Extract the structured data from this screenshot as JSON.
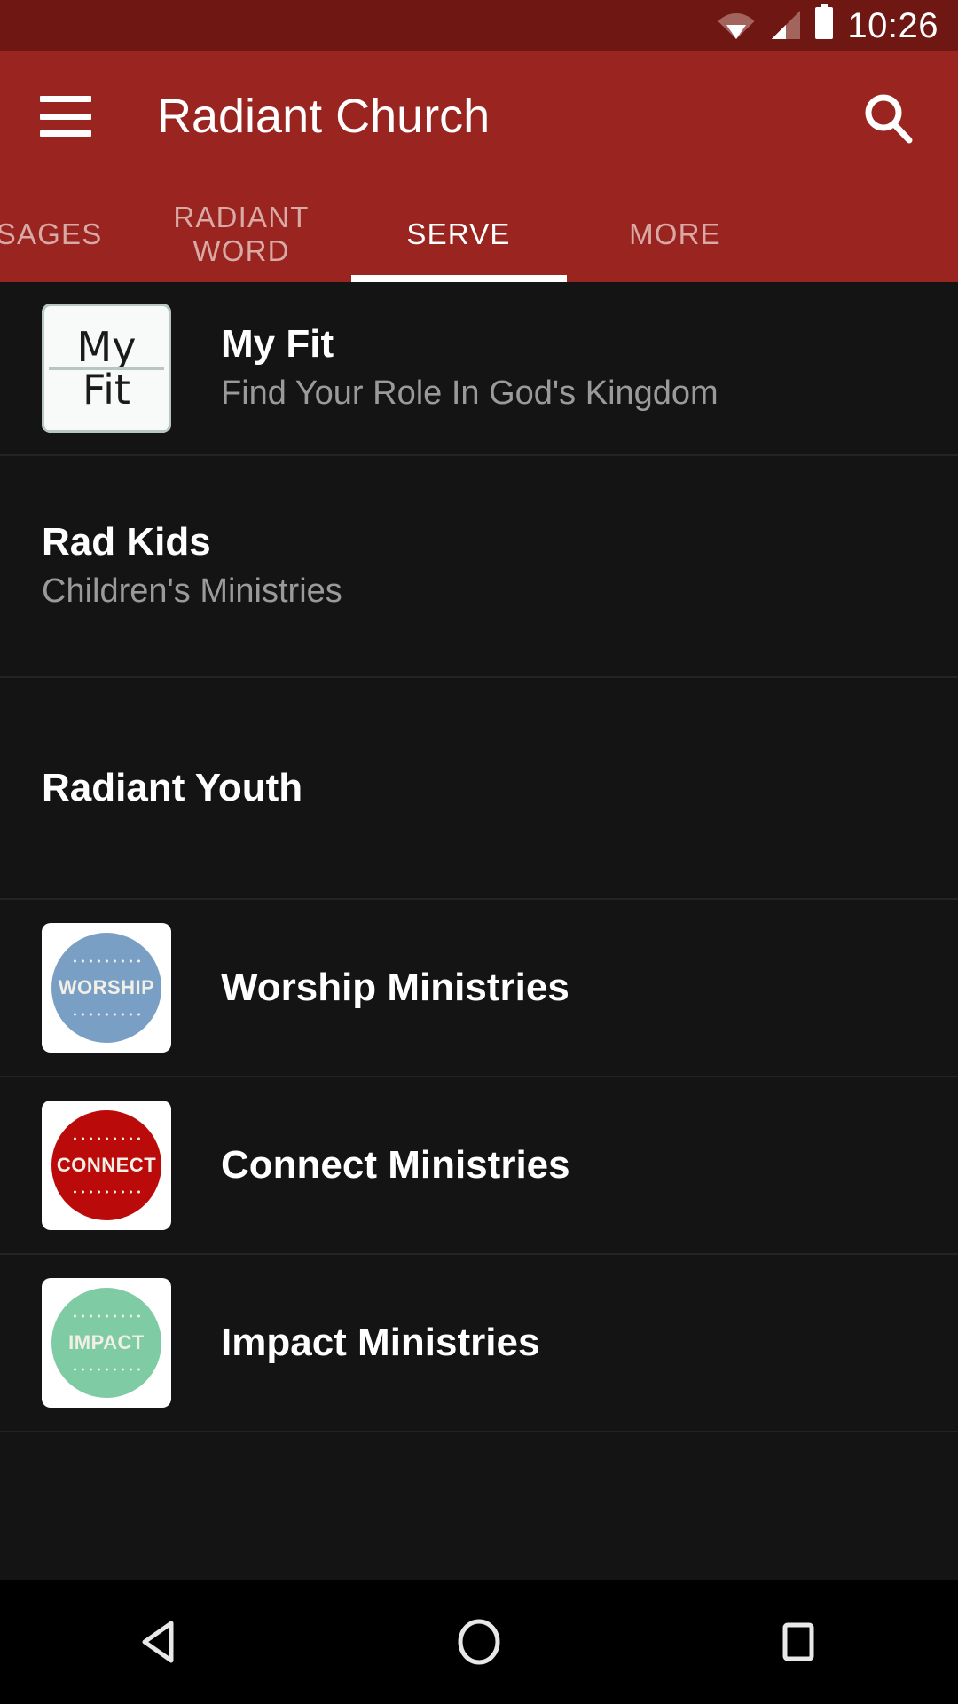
{
  "status_bar": {
    "time": "10:26",
    "icons": [
      "wifi-icon",
      "signal-icon",
      "battery-icon"
    ]
  },
  "app_bar": {
    "menu_icon": "hamburger-menu-icon",
    "title": "Radiant Church",
    "search_icon": "search-icon"
  },
  "tabs": {
    "active_index": 2,
    "items": [
      {
        "label": "SSAGES"
      },
      {
        "label": "RADIANT WORD"
      },
      {
        "label": "SERVE"
      },
      {
        "label": "MORE"
      }
    ]
  },
  "list": {
    "rows": [
      {
        "title": "My Fit",
        "subtitle": "Find Your Role In God's Kingdom",
        "thumb": "my-fit-logo",
        "thumb_line1": "My",
        "thumb_line2": "Fit"
      },
      {
        "title": "Rad Kids",
        "subtitle": "Children's Ministries",
        "thumb": null
      },
      {
        "title": "Radiant Youth",
        "subtitle": "",
        "thumb": null
      },
      {
        "title": "Worship Ministries",
        "subtitle": "",
        "thumb": "worship-logo",
        "thumb_word": "WORSHIP",
        "thumb_color": "#7a9fc4"
      },
      {
        "title": "Connect Ministries",
        "subtitle": "",
        "thumb": "connect-logo",
        "thumb_word": "CONNECT",
        "thumb_color": "#bb0a0a"
      },
      {
        "title": "Impact Ministries",
        "subtitle": "",
        "thumb": "impact-logo",
        "thumb_word": "IMPACT",
        "thumb_color": "#7ecba4"
      }
    ]
  },
  "nav_bar": {
    "back_icon": "back-triangle-icon",
    "home_icon": "home-circle-icon",
    "recents_icon": "recents-square-icon"
  },
  "colors": {
    "status_bar": "#6f1712",
    "app_bar": "#9a2420",
    "page_bg": "#141414",
    "accent": "#ffffff",
    "tab_inactive": "#d9a9a5",
    "subtitle": "#9a9a9a",
    "divider": "#242424"
  }
}
